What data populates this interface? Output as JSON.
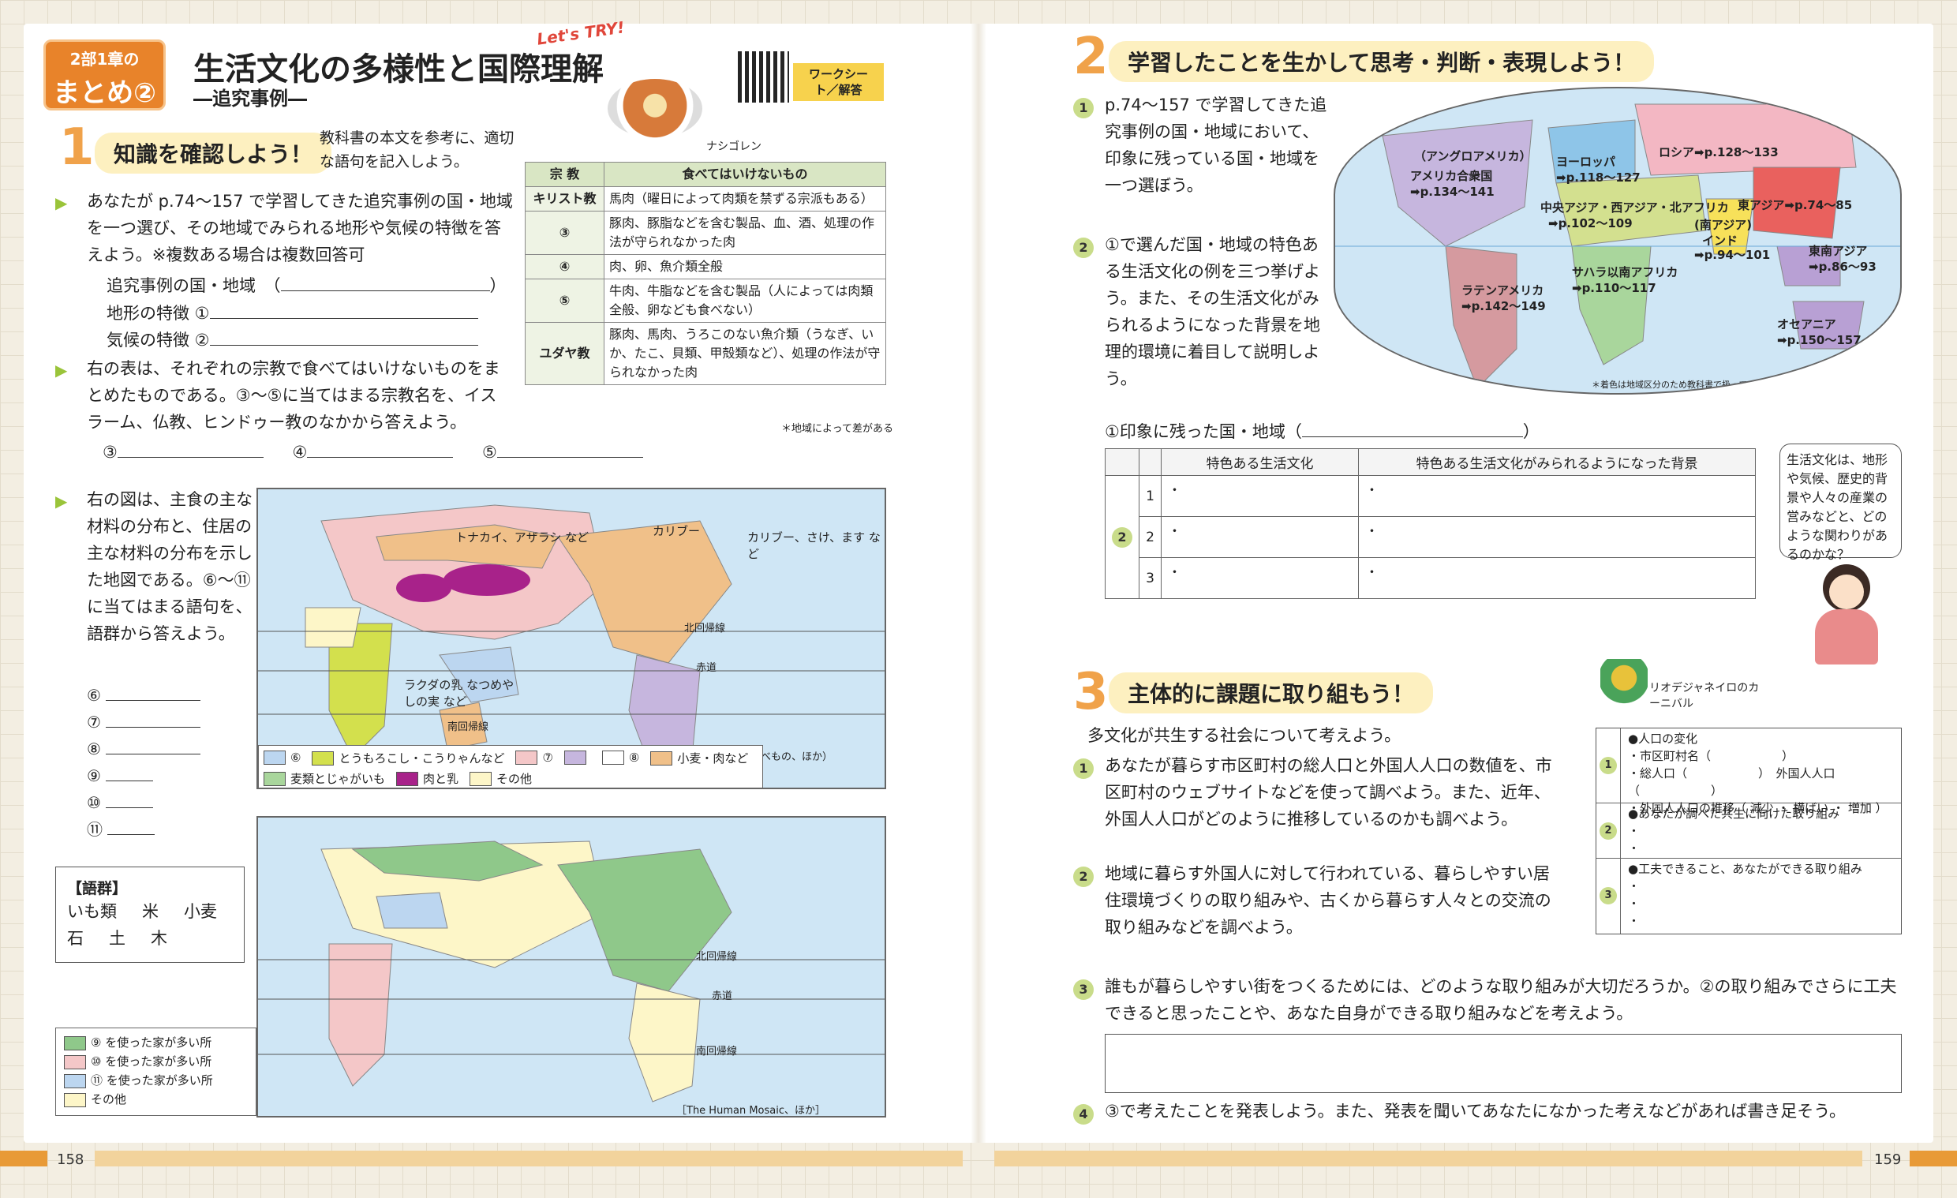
{
  "badge": {
    "line1": "2部1章の",
    "line2": "まとめ②"
  },
  "title": "生活文化の多様性と国際理解",
  "subtitle": "―追究事例―",
  "lets_try": "Let's TRY!",
  "food_caption": "ナシゴレン",
  "worksheet_tag": "ワークシート／解答",
  "sec1": {
    "num": "1",
    "head": "知識を確認しよう！",
    "intro": "教科書の本文を参考に、適切な語句を記入しよう。"
  },
  "q1": {
    "text": "あなたが p.74〜157 で学習してきた追究事例の国・地域を一つ選び、その地域でみられる地形や気候の特徴を答えよう。※複数ある場合は複数回答可",
    "l1": "追究事例の国・地域　（",
    "l1end": "）",
    "l2": "地形の特徴 ①",
    "l3": "気候の特徴 ②"
  },
  "q2": {
    "text": "右の表は、それぞれの宗教で食べてはいけないものをまとめたものである。③〜⑤に当てはまる宗教名を、イスラーム、仏教、ヒンドゥー教のなかから答えよう。",
    "a3": "③",
    "a4": "④",
    "a5": "⑤"
  },
  "religion_table": {
    "head": [
      "宗 教",
      "食べてはいけないもの"
    ],
    "rows": [
      [
        "キリスト教",
        "馬肉（曜日によって肉類を禁ずる宗派もある）"
      ],
      [
        "③",
        "豚肉、豚脂などを含む製品、血、酒、処理の作法が守られなかった肉"
      ],
      [
        "④",
        "肉、卵、魚介類全般"
      ],
      [
        "⑤",
        "牛肉、牛脂などを含む製品（人によっては肉類全般、卵なども食べない）"
      ],
      [
        "ユダヤ教",
        "豚肉、馬肉、うろこのない魚介類（うなぎ、いか、たこ、貝類、甲殻類など）、処理の作法が守られなかった肉"
      ]
    ],
    "note": "＊地域によって差がある"
  },
  "q3": {
    "text": "右の図は、主食の主な材料の分布と、住居の主な材料の分布を示した地図である。⑥〜⑪に当てはまる語句を、語群から答えよう。",
    "labels": [
      "⑥",
      "⑦",
      "⑧",
      "⑨",
      "⑩",
      "⑪"
    ]
  },
  "word_bank": {
    "title": "【語群】",
    "words": [
      "いも類",
      "米",
      "小麦",
      "石",
      "土",
      "木"
    ]
  },
  "map1": {
    "labels": [
      "トナカイ、アザラシ など",
      "カリブー",
      "カリブー、さけ、ます など",
      "北回帰線",
      "赤道",
      "南回帰線",
      "ラクダの乳 なつめやしの実 など"
    ],
    "source": "（朝日百科世界の食べもの、ほか）"
  },
  "map1_legend": [
    {
      "label": "⑥",
      "color": "#bcd6f0"
    },
    {
      "label": "とうもろこし・こうりゃんなど",
      "color": "#d3e04d"
    },
    {
      "label": "⑦",
      "color": "#f4c7c8"
    },
    {
      "label": "",
      "color": "#c6b6de"
    },
    {
      "label": "⑧",
      "color": "#ffffff"
    },
    {
      "label": "小麦・肉など",
      "color": "#f0c089"
    },
    {
      "label": "麦類とじゃがいも",
      "color": "#a9d69c"
    },
    {
      "label": "肉と乳",
      "color": "#a8228a"
    },
    {
      "label": "その他",
      "color": "#fdf6c8"
    }
  ],
  "map2": {
    "labels": [
      "北回帰線",
      "赤道",
      "南回帰線"
    ],
    "source": "［The Human Mosaic、ほか］"
  },
  "map2_legend": [
    {
      "label": "⑨ を使った家が多い所",
      "color": "#8fc88a"
    },
    {
      "label": "⑩ を使った家が多い所",
      "color": "#f4c7c8"
    },
    {
      "label": "⑪ を使った家が多い所",
      "color": "#bcd6f0"
    },
    {
      "label": "その他",
      "color": "#fdf6c8"
    }
  ],
  "sec2": {
    "num": "2",
    "head": "学習したことを生かして思考・判断・表現しよう！"
  },
  "p2q1": "p.74〜157 で学習してきた追究事例の国・地域において、印象に残っている国・地域を一つ選ぼう。",
  "p2q2": "①で選んだ国・地域の特色ある生活文化の例を三つ挙げよう。また、その生活文化がみられるようになった背景を地理的環境に着目して説明しよう。",
  "world_map": {
    "regions": [
      "（アングロアメリカ）",
      "アメリカ合衆国",
      "➡p.134〜141",
      "ヨーロッパ",
      "➡p.118〜127",
      "ロシア➡p.128〜133",
      "中央アジア・西アジア・北アフリカ",
      "➡p.102〜109",
      "東アジア➡p.74〜85",
      "(南アジア)",
      "インド",
      "➡p.94〜101",
      "東南アジア",
      "➡p.86〜93",
      "サハラ以南アフリカ",
      "➡p.110〜117",
      "ラテンアメリカ",
      "➡p.142〜149",
      "オセアニア",
      "➡p.150〜157"
    ],
    "note": "＊着色は地域区分のため教科書で扱っていない国を含む"
  },
  "impression": {
    "label": "①印象に残った国・地域（",
    "end": "）"
  },
  "culture_table": {
    "head": [
      "特色ある生活文化",
      "特色ある生活文化がみられるようになった背景"
    ],
    "rows": [
      "1",
      "2",
      "3"
    ],
    "bullet": "・",
    "side": "2"
  },
  "speech": "生活文化は、地形や気候、歴史的背景や人々の産業の営みなどと、どのような関わりがあるのかな？",
  "sec3": {
    "num": "3",
    "head": "主体的に課題に取り組もう！",
    "caption": "リオデジャネイロのカーニバル"
  },
  "p3intro": "多文化が共生する社会について考えよう。",
  "p3q1": "あなたが暮らす市区町村の総人口と外国人人口の数値を、市区町村のウェブサイトなどを使って調べよう。また、近年、外国人人口がどのように推移しているのかも調べよう。",
  "p3q2": "地域に暮らす外国人に対して行われている、暮らしやすい居住環境づくりの取り組みや、古くから暮らす人々との交流の取り組みなどを調べよう。",
  "p3q3": "誰もが暮らしやすい街をつくるためには、どのような取り組みが大切だろうか。②の取り組みでさらに工夫できると思ったことや、あなた自身ができる取り組みなどを考えよう。",
  "p3q4": "③で考えたことを発表しよう。また、発表を聞いてあなたになかった考えなどがあれば書き足そう。",
  "pop_box": {
    "r1": [
      "●人口の変化",
      "・市区町村名（　　　　　　）",
      "・総人口（　　　　　　）　外国人人口（　　　　　　）",
      "・外国人人口の推移（ 減少 ・ 横ばい ・ 増加 ）"
    ],
    "r2": [
      "●あなたが調べた共生に向けた取り組み",
      "・",
      "・"
    ],
    "r3": [
      "●工夫できること、あなたができる取り組み",
      "・",
      "・",
      "・"
    ]
  },
  "page_left": "158",
  "page_right": "159"
}
